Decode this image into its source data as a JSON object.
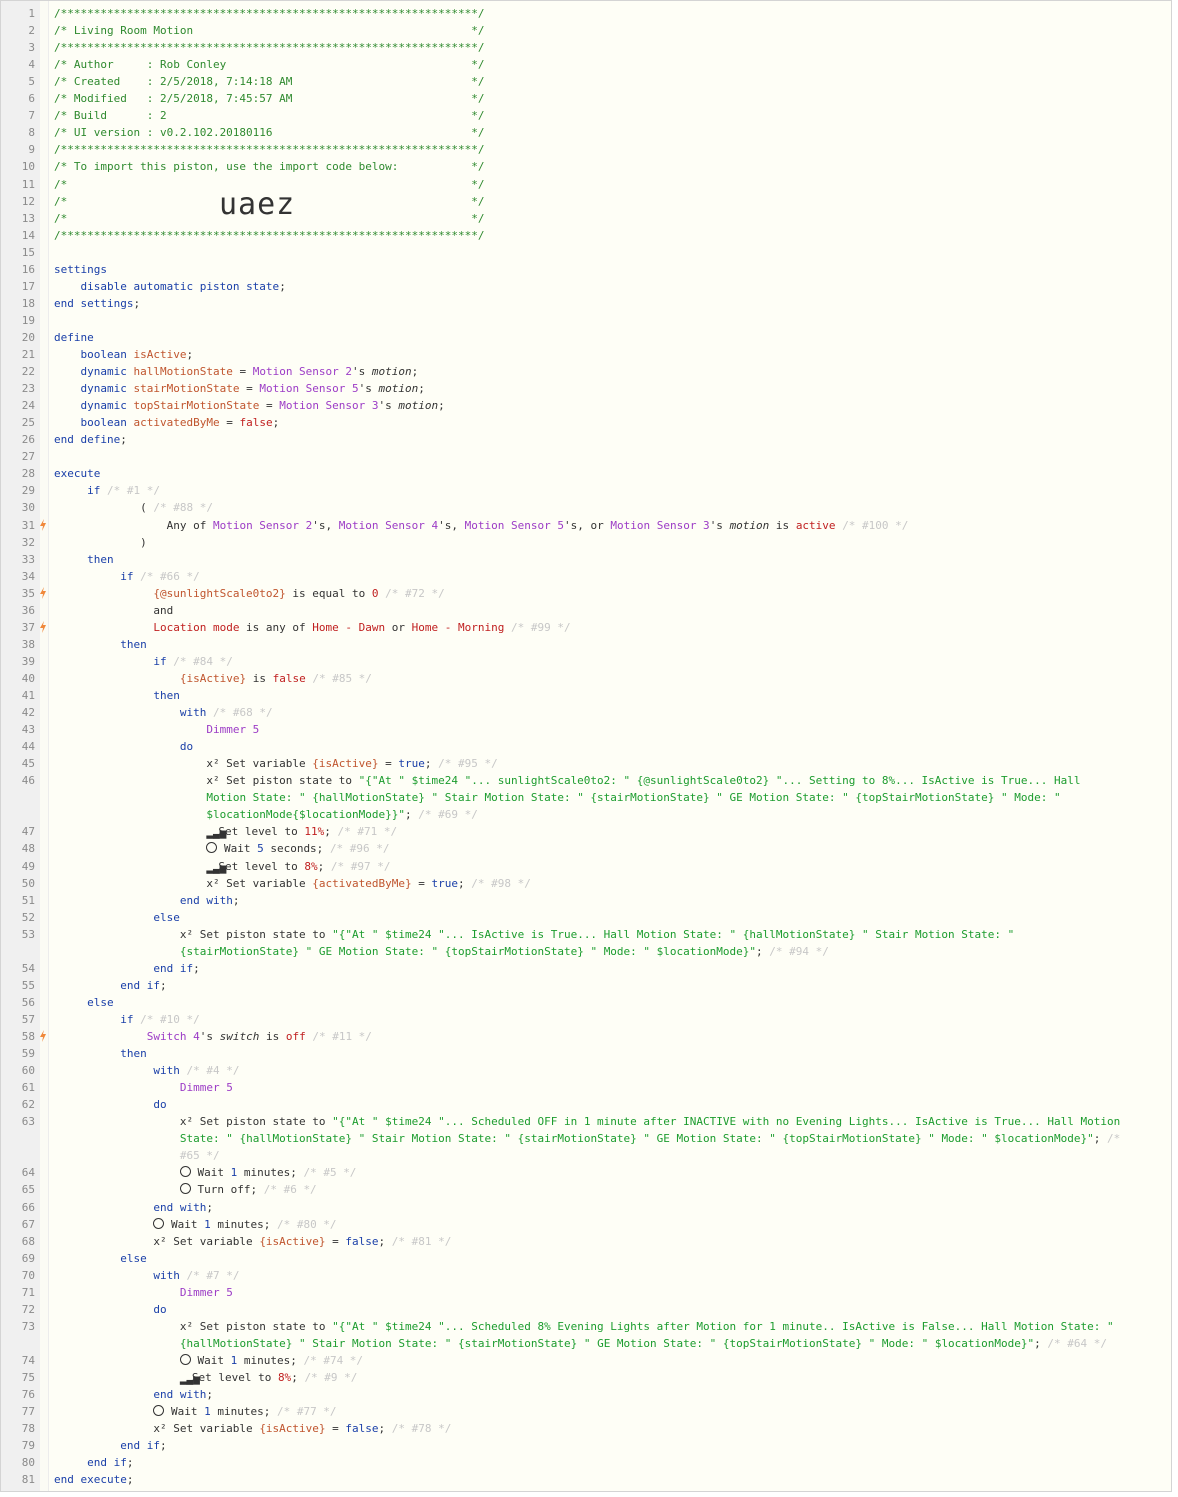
{
  "import_code": "uaez",
  "lines": [
    {
      "n": "1",
      "html": "<span class='c'>/***************************************************************/</span>"
    },
    {
      "n": "2",
      "html": "<span class='c'>/* Living Room Motion                                          */</span>"
    },
    {
      "n": "3",
      "html": "<span class='c'>/***************************************************************/</span>"
    },
    {
      "n": "4",
      "html": "<span class='c'>/* Author     : Rob Conley                                     */</span>"
    },
    {
      "n": "5",
      "html": "<span class='c'>/* Created    : 2/5/2018, 7:14:18 AM                           */</span>"
    },
    {
      "n": "6",
      "html": "<span class='c'>/* Modified   : 2/5/2018, 7:45:57 AM                           */</span>"
    },
    {
      "n": "7",
      "html": "<span class='c'>/* Build      : 2                                              */</span>"
    },
    {
      "n": "8",
      "html": "<span class='c'>/* UI version : v0.2.102.20180116                              */</span>"
    },
    {
      "n": "9",
      "html": "<span class='c'>/***************************************************************/</span>"
    },
    {
      "n": "10",
      "html": "<span class='c'>/* To import this piston, use the import code below:           */</span>"
    },
    {
      "n": "11",
      "html": "<span class='c'>/*                                                             */</span>"
    },
    {
      "n": "12",
      "html": "<span class='c'>/*                                                             */</span>"
    },
    {
      "n": "13",
      "html": "<span class='c'>/*                                                             */</span>"
    },
    {
      "n": "14",
      "html": "<span class='c'>/***************************************************************/</span>"
    },
    {
      "n": "15",
      "html": ""
    },
    {
      "n": "16",
      "html": "<span class='kw'>settings</span>"
    },
    {
      "n": "17",
      "html": "    <span class='kw'>disable automatic piston state</span>;"
    },
    {
      "n": "18",
      "html": "<span class='kw'>end settings</span>;"
    },
    {
      "n": "19",
      "html": ""
    },
    {
      "n": "20",
      "html": "<span class='kw'>define</span>"
    },
    {
      "n": "21",
      "html": "    <span class='kw'>boolean</span> <span class='var'>isActive</span>;"
    },
    {
      "n": "22",
      "html": "    <span class='kw'>dynamic</span> <span class='var'>hallMotionState</span> = <span class='dev'>Motion Sensor 2</span>'s <span class='it'>motion</span>;"
    },
    {
      "n": "23",
      "html": "    <span class='kw'>dynamic</span> <span class='var'>stairMotionState</span> = <span class='dev'>Motion Sensor 5</span>'s <span class='it'>motion</span>;"
    },
    {
      "n": "24",
      "html": "    <span class='kw'>dynamic</span> <span class='var'>topStairMotionState</span> = <span class='dev'>Motion Sensor 3</span>'s <span class='it'>motion</span>;"
    },
    {
      "n": "25",
      "html": "    <span class='kw'>boolean</span> <span class='var'>activatedByMe</span> = <span class='num'>false</span>;"
    },
    {
      "n": "26",
      "html": "<span class='kw'>end define</span>;"
    },
    {
      "n": "27",
      "html": ""
    },
    {
      "n": "28",
      "html": "<span class='kw'>execute</span>"
    },
    {
      "n": "29",
      "html": "     <span class='kw'>if</span> <span class='cm'>/* #1 */</span>"
    },
    {
      "n": "30",
      "html": "             ( <span class='cm'>/* #88 */</span>"
    },
    {
      "n": "31",
      "html": "                 Any of <span class='dev'>Motion Sensor 2</span>'s, <span class='dev'>Motion Sensor 4</span>'s, <span class='dev'>Motion Sensor 5</span>'s, or <span class='dev'>Motion Sensor 3</span>'s <span class='it'>motion</span> is <span class='num'>active</span> <span class='cm'>/* #100 */</span>"
    },
    {
      "n": "32",
      "html": "             )"
    },
    {
      "n": "33",
      "html": "     <span class='kw'>then</span>"
    },
    {
      "n": "34",
      "html": "          <span class='kw'>if</span> <span class='cm'>/* #66 */</span>"
    },
    {
      "n": "35",
      "html": "               <span class='var'>{@sunlightScale0to2}</span> is equal to <span class='num'>0</span> <span class='cm'>/* #72 */</span>"
    },
    {
      "n": "36",
      "html": "               and"
    },
    {
      "n": "37",
      "html": "               <span class='num'>Location mode</span> is any of <span class='num'>Home - Dawn</span> or <span class='num'>Home - Morning</span> <span class='cm'>/* #99 */</span>"
    },
    {
      "n": "38",
      "html": "          <span class='kw'>then</span>"
    },
    {
      "n": "39",
      "html": "               <span class='kw'>if</span> <span class='cm'>/* #84 */</span>"
    },
    {
      "n": "40",
      "html": "                   <span class='var'>{isActive}</span> is <span class='num'>false</span> <span class='cm'>/* #85 */</span>"
    },
    {
      "n": "41",
      "html": "               <span class='kw'>then</span>"
    },
    {
      "n": "42",
      "html": "                   <span class='kw'>with</span> <span class='cm'>/* #68 */</span>"
    },
    {
      "n": "43",
      "html": "                       <span class='dev'>Dimmer 5</span>"
    },
    {
      "n": "44",
      "html": "                   <span class='kw'>do</span>"
    },
    {
      "n": "45",
      "html": "                       x² Set variable <span class='var'>{isActive}</span> = <span class='kw'>true</span>; <span class='cm'>/* #95 */</span>"
    },
    {
      "n": "46",
      "html": "                       x² Set piston state to <span class='str'>\"{\"At \" $time24 \"... sunlightScale0to2: \" {@sunlightScale0to2} \"... Setting to 8%... IsActive is True... Hall</span>"
    },
    {
      "n": "",
      "html": "                       <span class='str'>Motion State: \" {hallMotionState} \" Stair Motion State: \" {stairMotionState} \" GE Motion State: \" {topStairMotionState} \" Mode: \"</span>"
    },
    {
      "n": "",
      "html": "                       <span class='str'>$locationMode{$locationMode}}\"</span>; <span class='cm'>/* #69 */</span>"
    },
    {
      "n": "47",
      "html": "                       <span class='ic-s'>▂▃▅</span>Set level to <span class='num'>11%</span>; <span class='cm'>/* #71 */</span>"
    },
    {
      "n": "48",
      "html": "                       <span class='ic'></span> Wait <span class='kw'>5</span> seconds; <span class='cm'>/* #96 */</span>"
    },
    {
      "n": "49",
      "html": "                       <span class='ic-s'>▂▃▅</span>Set level to <span class='num'>8%</span>; <span class='cm'>/* #97 */</span>"
    },
    {
      "n": "50",
      "html": "                       x² Set variable <span class='var'>{activatedByMe}</span> = <span class='kw'>true</span>; <span class='cm'>/* #98 */</span>"
    },
    {
      "n": "51",
      "html": "                   <span class='kw'>end with</span>;"
    },
    {
      "n": "52",
      "html": "               <span class='kw'>else</span>"
    },
    {
      "n": "53",
      "html": "                   x² Set piston state to <span class='str'>\"{\"At \" $time24 \"... IsActive is True... Hall Motion State: \" {hallMotionState} \" Stair Motion State: \"</span>"
    },
    {
      "n": "",
      "html": "                   <span class='str'>{stairMotionState} \" GE Motion State: \" {topStairMotionState} \" Mode: \" $locationMode}\"</span>; <span class='cm'>/* #94 */</span>"
    },
    {
      "n": "54",
      "html": "               <span class='kw'>end if</span>;"
    },
    {
      "n": "55",
      "html": "          <span class='kw'>end if</span>;"
    },
    {
      "n": "56",
      "html": "     <span class='kw'>else</span>"
    },
    {
      "n": "57",
      "html": "          <span class='kw'>if</span> <span class='cm'>/* #10 */</span>"
    },
    {
      "n": "58",
      "html": "              <span class='dev'>Switch 4</span>'s <span class='it'>switch</span> is <span class='num'>off</span> <span class='cm'>/* #11 */</span>"
    },
    {
      "n": "59",
      "html": "          <span class='kw'>then</span>"
    },
    {
      "n": "60",
      "html": "               <span class='kw'>with</span> <span class='cm'>/* #4 */</span>"
    },
    {
      "n": "61",
      "html": "                   <span class='dev'>Dimmer 5</span>"
    },
    {
      "n": "62",
      "html": "               <span class='kw'>do</span>"
    },
    {
      "n": "63",
      "html": "                   x² Set piston state to <span class='str'>\"{\"At \" $time24 \"... Scheduled OFF in 1 minute after INACTIVE with no Evening Lights... IsActive is True... Hall Motion</span>"
    },
    {
      "n": "",
      "html": "                   <span class='str'>State: \" {hallMotionState} \" Stair Motion State: \" {stairMotionState} \" GE Motion State: \" {topStairMotionState} \" Mode: \" $locationMode}\"</span>; <span class='cm'>/*</span>"
    },
    {
      "n": "",
      "html": "                   <span class='cm'>#65 */</span>"
    },
    {
      "n": "64",
      "html": "                   <span class='ic'></span> Wait <span class='kw'>1</span> minutes; <span class='cm'>/* #5 */</span>"
    },
    {
      "n": "65",
      "html": "                   <span class='ic'></span> Turn off; <span class='cm'>/* #6 */</span>"
    },
    {
      "n": "66",
      "html": "               <span class='kw'>end with</span>;"
    },
    {
      "n": "67",
      "html": "               <span class='ic'></span> Wait <span class='kw'>1</span> minutes; <span class='cm'>/* #80 */</span>"
    },
    {
      "n": "68",
      "html": "               x² Set variable <span class='var'>{isActive}</span> = <span class='kw'>false</span>; <span class='cm'>/* #81 */</span>"
    },
    {
      "n": "69",
      "html": "          <span class='kw'>else</span>"
    },
    {
      "n": "70",
      "html": "               <span class='kw'>with</span> <span class='cm'>/* #7 */</span>"
    },
    {
      "n": "71",
      "html": "                   <span class='dev'>Dimmer 5</span>"
    },
    {
      "n": "72",
      "html": "               <span class='kw'>do</span>"
    },
    {
      "n": "73",
      "html": "                   x² Set piston state to <span class='str'>\"{\"At \" $time24 \"... Scheduled 8% Evening Lights after Motion for 1 minute.. IsActive is False... Hall Motion State: \"</span>"
    },
    {
      "n": "",
      "html": "                   <span class='str'>{hallMotionState} \" Stair Motion State: \" {stairMotionState} \" GE Motion State: \" {topStairMotionState} \" Mode: \" $locationMode}\"</span>; <span class='cm'>/* #64 */</span>"
    },
    {
      "n": "74",
      "html": "                   <span class='ic'></span> Wait <span class='kw'>1</span> minutes; <span class='cm'>/* #74 */</span>"
    },
    {
      "n": "75",
      "html": "                   <span class='ic-s'>▂▃▅</span>Set level to <span class='num'>8%</span>; <span class='cm'>/* #9 */</span>"
    },
    {
      "n": "76",
      "html": "               <span class='kw'>end with</span>;"
    },
    {
      "n": "77",
      "html": "               <span class='ic'></span> Wait <span class='kw'>1</span> minutes; <span class='cm'>/* #77 */</span>"
    },
    {
      "n": "78",
      "html": "               x² Set variable <span class='var'>{isActive}</span> = <span class='kw'>false</span>; <span class='cm'>/* #78 */</span>"
    },
    {
      "n": "79",
      "html": "          <span class='kw'>end if</span>;"
    },
    {
      "n": "80",
      "html": "     <span class='kw'>end if</span>;"
    },
    {
      "n": "81",
      "html": "<span class='kw'>end execute</span>;"
    }
  ],
  "trigger_lines": [
    "31",
    "35",
    "37",
    "58"
  ],
  "colors": {
    "trigger_bolt": "#f0883a",
    "keyword": "#1a3fa8",
    "variable": "#c0552e",
    "device": "#9c3cc6",
    "value": "#c02020",
    "string": "#1c9c2e"
  }
}
